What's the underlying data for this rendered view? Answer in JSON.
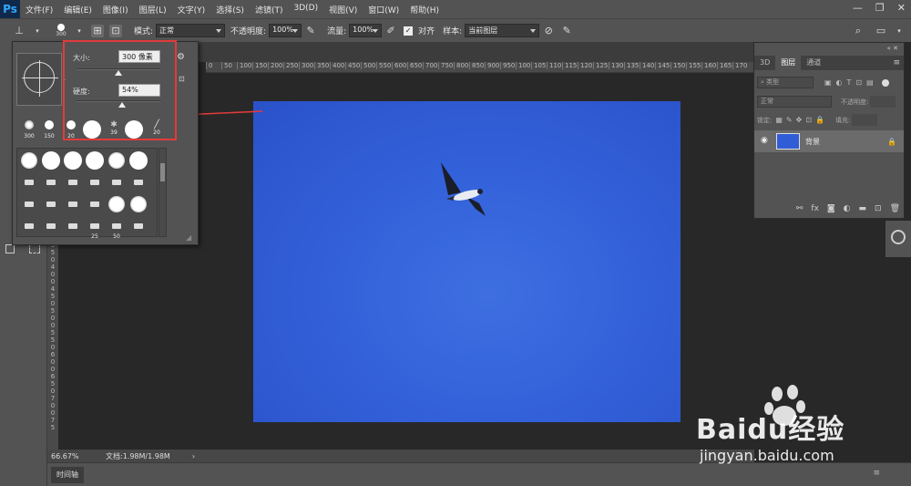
{
  "app": {
    "logo": "Ps"
  },
  "menu": [
    "文件(F)",
    "编辑(E)",
    "图像(I)",
    "图层(L)",
    "文字(Y)",
    "选择(S)",
    "滤镜(T)",
    "3D(D)",
    "视图(V)",
    "窗口(W)",
    "帮助(H)"
  ],
  "options": {
    "brush_size": "300",
    "mode_label": "模式:",
    "mode_value": "正常",
    "opacity_label": "不透明度:",
    "opacity_value": "100%",
    "flow_label": "流量:",
    "flow_value": "100%",
    "align_label": "对齐",
    "sample_label": "样本:",
    "sample_value": "当前图层"
  },
  "brush_panel": {
    "size_label": "大小:",
    "size_value": "300 像素",
    "size_fraction": 0.5,
    "hardness_label": "硬度:",
    "hardness_value": "54%",
    "hardness_fraction": 0.54,
    "presets": [
      "300",
      "150",
      "20",
      "",
      "39",
      "",
      "20"
    ],
    "grid_labels": [
      "25",
      "50"
    ]
  },
  "ruler": {
    "h_ticks": [
      "0",
      "50",
      "100",
      "150",
      "200",
      "250",
      "300",
      "350",
      "400",
      "450",
      "500",
      "550",
      "600",
      "650",
      "700",
      "750",
      "800",
      "850",
      "900",
      "950",
      "100",
      "105",
      "110",
      "115",
      "120",
      "125",
      "130",
      "135",
      "140",
      "145",
      "150",
      "155",
      "160",
      "165",
      "170"
    ],
    "v_ticks": [
      "3",
      "5",
      "0",
      "4",
      "0",
      "0",
      "4",
      "5",
      "0",
      "5",
      "0",
      "0",
      "5",
      "5",
      "0",
      "6",
      "0",
      "0",
      "6",
      "5",
      "0",
      "7",
      "0",
      "0",
      "7",
      "5"
    ]
  },
  "status": {
    "zoom": "66.67%",
    "doc": "文档:1.98M/1.98M"
  },
  "timeline": {
    "tab": "时间轴"
  },
  "layers": {
    "tabs": [
      "3D",
      "图层",
      "通道"
    ],
    "active_tab": "图层",
    "filter_label": "类型",
    "blend_mode": "正常",
    "opacity_label": "不透明度:",
    "lock_label": "锁定:",
    "fill_label": "填充:",
    "layer_name": "背景"
  },
  "watermark": {
    "brand": "Baidu经验",
    "url": "jingyan.baidu.com"
  }
}
